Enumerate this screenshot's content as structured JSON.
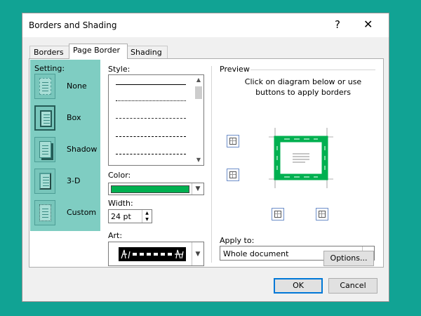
{
  "window": {
    "title": "Borders and Shading",
    "help": "?",
    "close": "✕"
  },
  "tabs": [
    {
      "label": "Borders",
      "active": false
    },
    {
      "label": "Page Border",
      "active": true
    },
    {
      "label": "Shading",
      "active": false
    }
  ],
  "setting": {
    "label": "Setting:",
    "options": [
      {
        "label": "None",
        "icon": "page-none-icon",
        "selected": false
      },
      {
        "label": "Box",
        "icon": "page-box-icon",
        "selected": true
      },
      {
        "label": "Shadow",
        "icon": "page-shadow-icon",
        "selected": false
      },
      {
        "label": "3-D",
        "icon": "page-3d-icon",
        "selected": false
      },
      {
        "label": "Custom",
        "icon": "page-custom-icon",
        "selected": false
      }
    ]
  },
  "style": {
    "label": "Style:",
    "lines": [
      "solid",
      "dotted",
      "dashed-small",
      "dashed",
      "dash-dot"
    ]
  },
  "color": {
    "label": "Color:",
    "value": "#00b050"
  },
  "width": {
    "label": "Width:",
    "value": "24 pt"
  },
  "art": {
    "label": "Art:"
  },
  "preview": {
    "label": "Preview",
    "hint": "Click on diagram below or use buttons to apply borders"
  },
  "apply_to": {
    "label": "Apply to:",
    "value": "Whole document"
  },
  "buttons": {
    "options": "Options...",
    "ok": "OK",
    "cancel": "Cancel"
  },
  "colors": {
    "accent": "#00b050",
    "background": "#11a394",
    "setting_bg": "#7fcdc2"
  }
}
